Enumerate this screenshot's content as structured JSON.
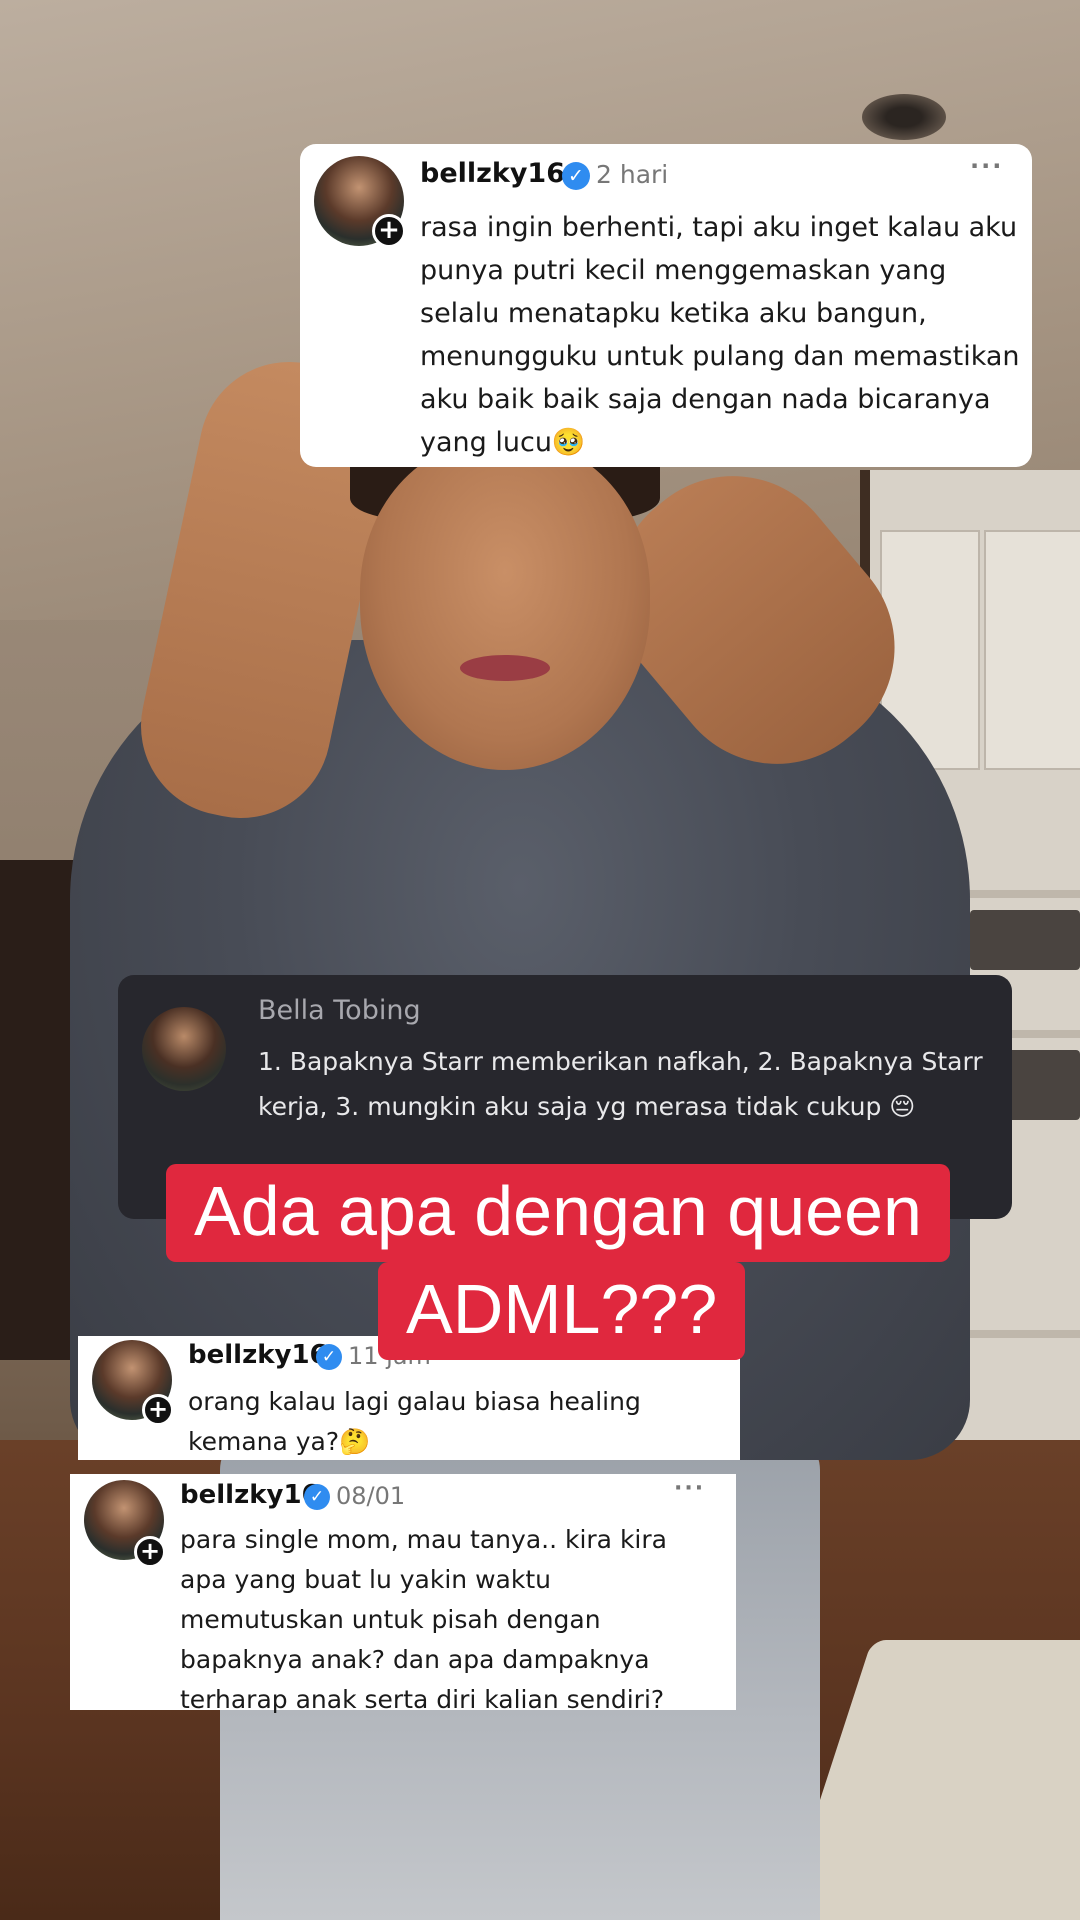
{
  "comments": [
    {
      "username": "bellzky16",
      "verified_mark": "✓",
      "time": "2 hari",
      "more": "···",
      "text": "rasa ingin berhenti, tapi aku inget kalau aku punya putri kecil menggemaskan yang selalu menatapku ketika aku bangun, menungguku untuk pulang dan memastikan aku baik baik saja dengan nada bicaranya yang lucu🥹",
      "theme": "light"
    },
    {
      "username": "Bella Tobing",
      "text": "1. Bapaknya Starr memberikan nafkah, 2. Bapaknya Starr kerja, 3. mungkin aku saja yg merasa tidak cukup 😔",
      "theme": "dark"
    },
    {
      "username": "bellzky16",
      "verified_mark": "✓",
      "time": "11 jam",
      "more": "···",
      "text": "orang kalau lagi galau biasa healing kemana ya?🤔",
      "theme": "light"
    },
    {
      "username": "bellzky16",
      "verified_mark": "✓",
      "time": "08/01",
      "more": "···",
      "text": "para single mom, mau tanya.. kira kira apa yang buat lu yakin waktu memutuskan untuk pisah dengan bapaknya anak? dan apa dampaknya terharap anak serta diri kalian sendiri?",
      "theme": "light"
    }
  ],
  "caption": {
    "line1": "Ada apa dengan queen",
    "line2": "ADML???",
    "color": "#e0283e"
  },
  "icons": {
    "plus": "+",
    "verified": "verified-badge-icon"
  },
  "colors": {
    "verified_blue": "#2f8cf0",
    "dark_card": "#27272d"
  }
}
